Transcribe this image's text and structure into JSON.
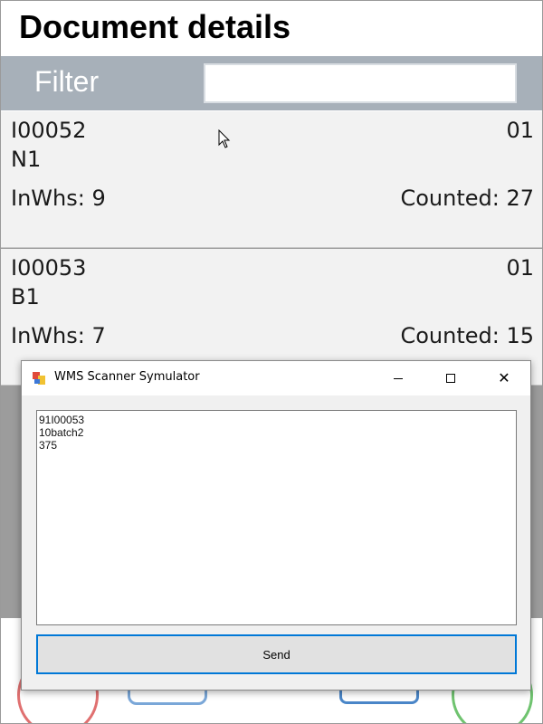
{
  "app": {
    "title": "Document details",
    "filter": {
      "label": "Filter",
      "value": "",
      "placeholder": ""
    },
    "items": [
      {
        "code": "I00052",
        "number": "01",
        "location": "N1",
        "in_whs": "InWhs: 9",
        "counted": "Counted: 27"
      },
      {
        "code": "I00053",
        "number": "01",
        "location": "B1",
        "in_whs": "InWhs: 7",
        "counted": "Counted: 15"
      }
    ],
    "bottom_buttons": [
      "cancel-circle-icon",
      "rounded-blue-button",
      "scanner-icon",
      "confirm-circle-icon"
    ]
  },
  "dialog": {
    "title": "WMS Scanner Symulator",
    "scan_text": "91I00053\n10batch2\n375",
    "send_label": "Send",
    "icons": {
      "app": "app-window-icon",
      "minimize": "minimize-icon",
      "maximize": "maximize-icon",
      "close": "close-icon"
    }
  },
  "colors": {
    "filter_bar": "#a7b0b9",
    "list_background": "#9c9c9c",
    "send_border": "#0078d7"
  }
}
